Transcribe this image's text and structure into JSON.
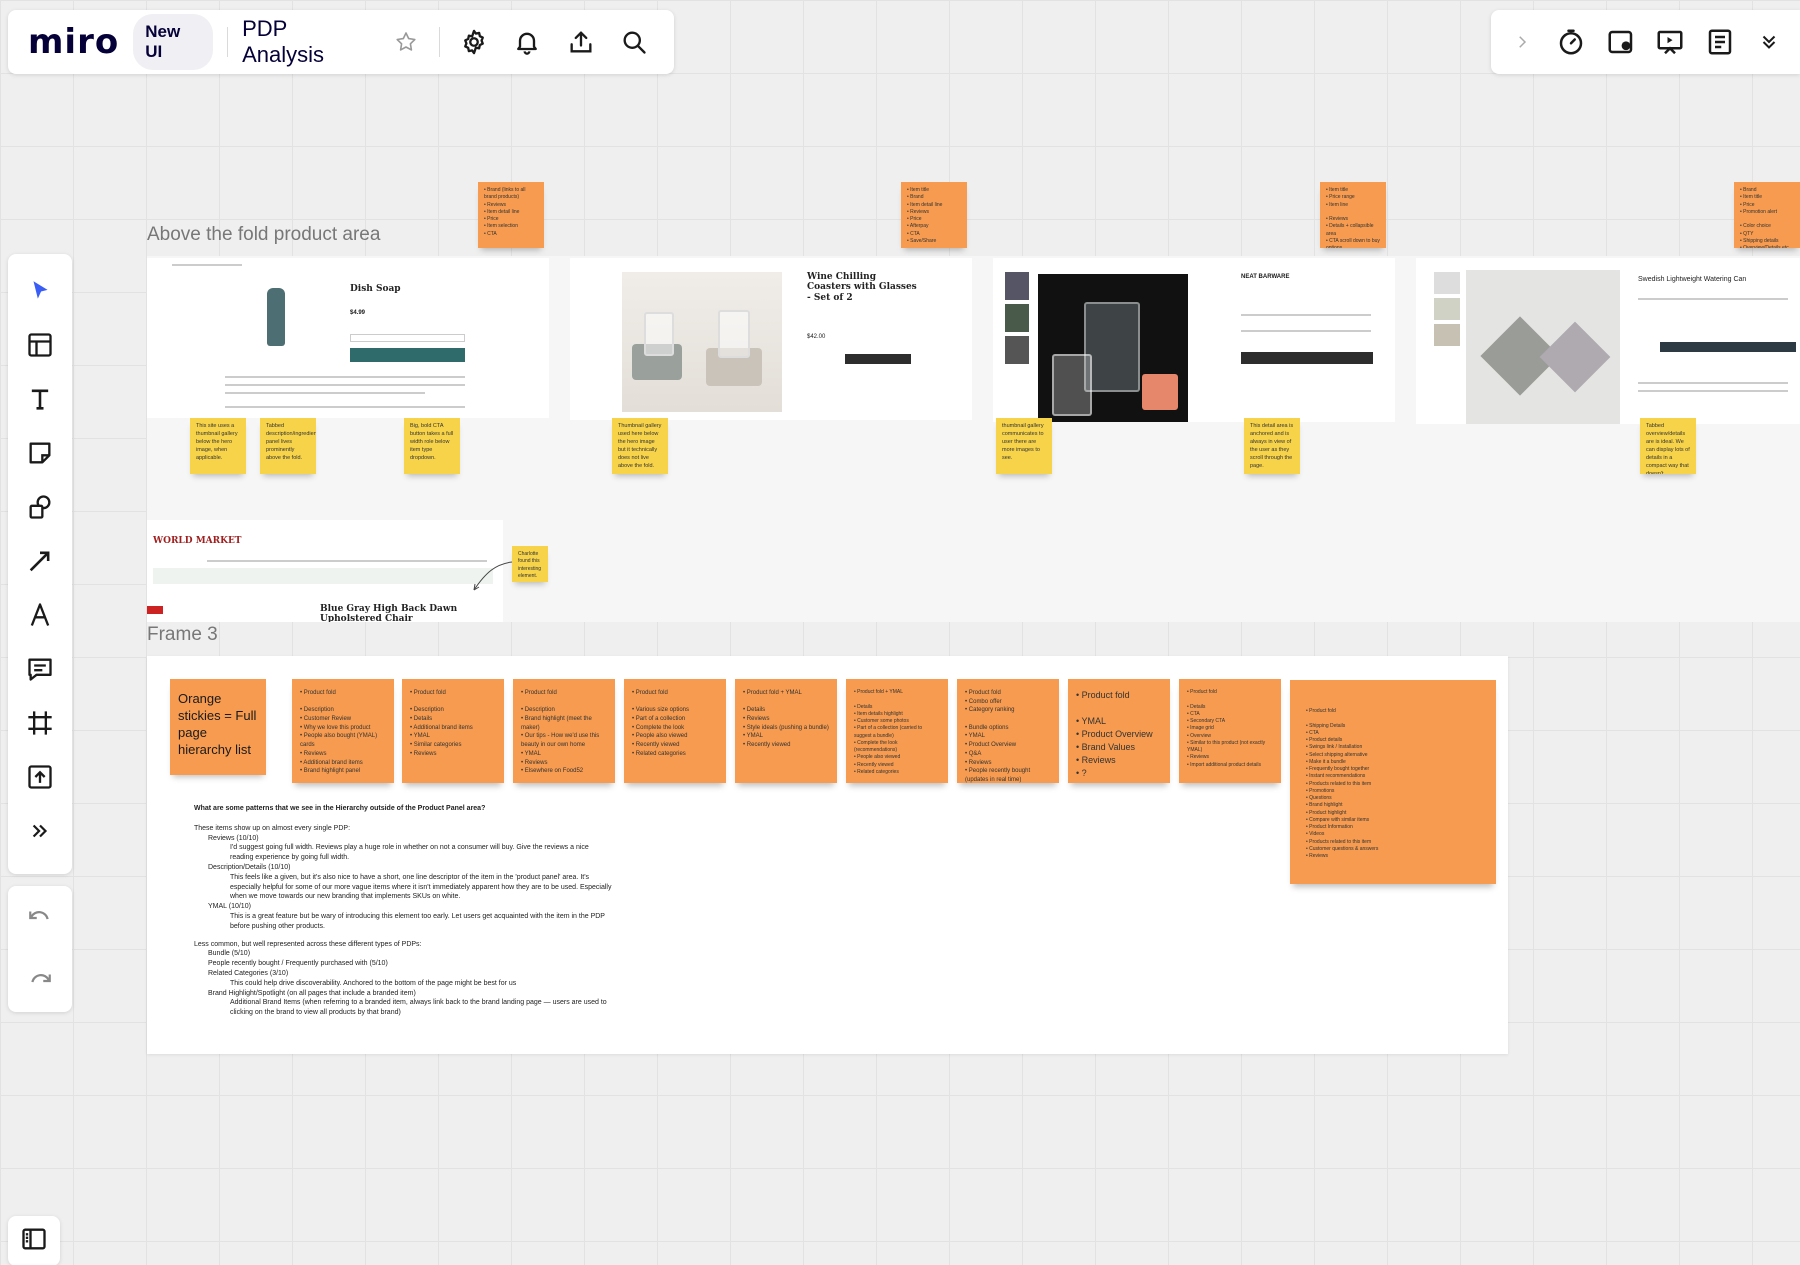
{
  "header": {
    "logo": "miro",
    "badge": "New UI",
    "board_title": "PDP Analysis"
  },
  "frames": {
    "above_fold_label": "Above the fold product area",
    "frame3_label": "Frame 3"
  },
  "shots": {
    "dish_soap": {
      "title": "Dish Soap",
      "price": "$4.99"
    },
    "coasters": {
      "title": "Wine Chilling Coasters with Glasses - Set of 2",
      "price": "$42.00"
    },
    "barware": {
      "brand": "NEAT BARWARE"
    },
    "watering_can": {
      "title": "Swedish Lightweight Watering Can"
    },
    "world_market": {
      "logo": "WORLD MARKET",
      "title": "Blue Gray High Back Dawn Upholstered Chair"
    }
  },
  "top_stickies": [
    "• Brand (links to all brand products)\n• Reviews\n• Item detail line\n• Price\n• Item selection\n• CTA",
    "• Item title\n• Brand\n• Item detail line\n• Reviews\n• Price\n• Afterpay\n• CTA\n• Save/Share",
    "• Item title\n• Price range\n• Item line\n\n• Reviews\n• Details + collapsible area\n• CTA scroll down to buy options",
    "• Brand\n• Item title\n• Price\n• Promotion alert\n\n• Color choice\n• QTY\n• Shipping details\n• Overview/Details etc."
  ],
  "yellow_stickies": [
    "This site uses a thumbnail gallery below the hero image, when applicable.",
    "Tabbed description/ingredients, panel lives prominently above the fold.",
    "Big, bold CTA button takes a full width role below item type dropdown.",
    "Thumbnail gallery used here below the hero image but it technically does not live above the fold.",
    "thumbnail gallery communicates to user there are more images to see.",
    "This detail area is anchored and is always in view of the user as they scroll through the page.",
    "Tabbed overview/details are is ideal. We can display lots of details in a compact way that doesn't overwhelm the user.",
    "Charlotte found this interesting element."
  ],
  "legend_sticky": "Orange stickies = Full page hierarchy list",
  "hierarchy_stickies": [
    "• Product fold\n\n• Description\n• Customer Review\n• Why we love this product\n• People also bought (YMAL) cards\n• Reviews\n• Additional brand items\n• Brand highlight panel",
    "• Product fold\n\n• Description\n• Details\n• Additional brand items\n• YMAL\n• Similar categories\n• Reviews",
    "• Product fold\n\n• Description\n• Brand highlight (meet the maker)\n• Our tips - How we'd use this beauty in our own home\n• YMAL\n• Reviews\n• Elsewhere on Food52",
    "• Product fold\n\n• Various size options\n• Part of a collection\n• Complete the look\n• People also viewed\n• Recently viewed\n• Related categories",
    "• Product fold + YMAL\n\n• Details\n• Reviews\n• Style ideals (pushing a bundle)\n• YMAL\n• Recently viewed",
    "• Product fold + YMAL\n\n• Details\n• Item details highlight\n• Customer some photos\n• Part of a collection (carried to suggest a bundle)\n• Complete the look (recommendations)\n• People also viewed\n• Recently viewed\n• Related categories",
    "• Product fold\n• Combo offer\n• Category ranking\n\n• Bundle options\n• YMAL\n• Product Overview\n• Q&A\n• Reviews\n• People recently bought (updates in real time)",
    "• Product fold\n\n• YMAL\n• Product Overview\n• Brand Values\n• Reviews\n• ?",
    "• Product fold\n\n• Details\n• CTA\n• Secondary CTA\n• Image grid\n• Overview\n• Similar to this product (not exactly YMAL)\n• Reviews\n• Import additional product details",
    "• Product fold\n\n• Shipping Details\n• CTA\n• Product details\n• Swings link / Installation\n• Select shipping alternative\n• Make it a bundle\n• Frequently bought together\n• Instant recommendations\n• Products related to this item\n• Promotions\n• Questions\n• Brand highlight\n• Product highlight\n• Compare with similar items\n• Product Information\n• Videos\n• Products related to this item\n• Customer questions & answers\n• Reviews"
  ],
  "notes": {
    "question": "What are some patterns that we see in the Hierarchy outside of the Product Panel area?",
    "intro": "These items show up on almost every single PDP:",
    "l1": "Reviews (10/10)",
    "l1a": "I'd suggest going full width. Reviews play a huge role in whether on not a consumer will buy. Give the reviews a nice reading experience by going full width.",
    "l2": "Description/Details (10/10)",
    "l2a": "This feels like a given, but it's also nice to have a short, one line descriptor of the item in the 'product panel' area. It's especially helpful for some of our more vague items where it isn't immediately apparent how they are to be used. Especially when we move towards our new branding that implements SKUs on white.",
    "l3": "YMAL (10/10)",
    "l3a": "This is a great feature but be wary of introducing this element too early. Let users get acquainted with the item in the PDP before pushing other products.",
    "less": "Less common, but well represented across these different types of PDPs:",
    "m1": "Bundle (5/10)",
    "m2": "People recently bought / Frequently purchased with (5/10)",
    "m3": "Related Categories (3/10)",
    "m3a": "This could help drive discoverability. Anchored to the bottom of the page might be best for us",
    "m4": "Brand Highlight/Spotlight (on all pages that include a branded item)",
    "m4a": "Additional Brand Items (when referring to a branded item, always link back to the brand landing page — users are used to clicking on the brand to view all products by that brand)"
  }
}
